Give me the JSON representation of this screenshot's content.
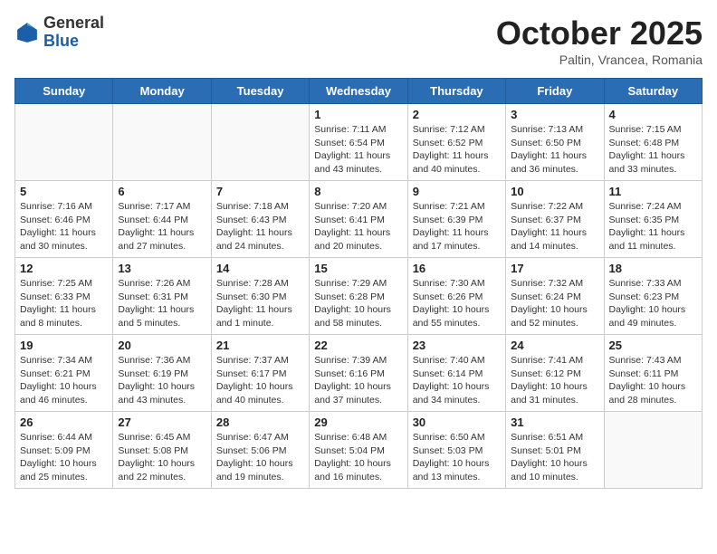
{
  "logo": {
    "general": "General",
    "blue": "Blue"
  },
  "title": "October 2025",
  "subtitle": "Paltin, Vrancea, Romania",
  "days_of_week": [
    "Sunday",
    "Monday",
    "Tuesday",
    "Wednesday",
    "Thursday",
    "Friday",
    "Saturday"
  ],
  "weeks": [
    [
      {
        "day": "",
        "info": ""
      },
      {
        "day": "",
        "info": ""
      },
      {
        "day": "",
        "info": ""
      },
      {
        "day": "1",
        "info": "Sunrise: 7:11 AM\nSunset: 6:54 PM\nDaylight: 11 hours and 43 minutes."
      },
      {
        "day": "2",
        "info": "Sunrise: 7:12 AM\nSunset: 6:52 PM\nDaylight: 11 hours and 40 minutes."
      },
      {
        "day": "3",
        "info": "Sunrise: 7:13 AM\nSunset: 6:50 PM\nDaylight: 11 hours and 36 minutes."
      },
      {
        "day": "4",
        "info": "Sunrise: 7:15 AM\nSunset: 6:48 PM\nDaylight: 11 hours and 33 minutes."
      }
    ],
    [
      {
        "day": "5",
        "info": "Sunrise: 7:16 AM\nSunset: 6:46 PM\nDaylight: 11 hours and 30 minutes."
      },
      {
        "day": "6",
        "info": "Sunrise: 7:17 AM\nSunset: 6:44 PM\nDaylight: 11 hours and 27 minutes."
      },
      {
        "day": "7",
        "info": "Sunrise: 7:18 AM\nSunset: 6:43 PM\nDaylight: 11 hours and 24 minutes."
      },
      {
        "day": "8",
        "info": "Sunrise: 7:20 AM\nSunset: 6:41 PM\nDaylight: 11 hours and 20 minutes."
      },
      {
        "day": "9",
        "info": "Sunrise: 7:21 AM\nSunset: 6:39 PM\nDaylight: 11 hours and 17 minutes."
      },
      {
        "day": "10",
        "info": "Sunrise: 7:22 AM\nSunset: 6:37 PM\nDaylight: 11 hours and 14 minutes."
      },
      {
        "day": "11",
        "info": "Sunrise: 7:24 AM\nSunset: 6:35 PM\nDaylight: 11 hours and 11 minutes."
      }
    ],
    [
      {
        "day": "12",
        "info": "Sunrise: 7:25 AM\nSunset: 6:33 PM\nDaylight: 11 hours and 8 minutes."
      },
      {
        "day": "13",
        "info": "Sunrise: 7:26 AM\nSunset: 6:31 PM\nDaylight: 11 hours and 5 minutes."
      },
      {
        "day": "14",
        "info": "Sunrise: 7:28 AM\nSunset: 6:30 PM\nDaylight: 11 hours and 1 minute."
      },
      {
        "day": "15",
        "info": "Sunrise: 7:29 AM\nSunset: 6:28 PM\nDaylight: 10 hours and 58 minutes."
      },
      {
        "day": "16",
        "info": "Sunrise: 7:30 AM\nSunset: 6:26 PM\nDaylight: 10 hours and 55 minutes."
      },
      {
        "day": "17",
        "info": "Sunrise: 7:32 AM\nSunset: 6:24 PM\nDaylight: 10 hours and 52 minutes."
      },
      {
        "day": "18",
        "info": "Sunrise: 7:33 AM\nSunset: 6:23 PM\nDaylight: 10 hours and 49 minutes."
      }
    ],
    [
      {
        "day": "19",
        "info": "Sunrise: 7:34 AM\nSunset: 6:21 PM\nDaylight: 10 hours and 46 minutes."
      },
      {
        "day": "20",
        "info": "Sunrise: 7:36 AM\nSunset: 6:19 PM\nDaylight: 10 hours and 43 minutes."
      },
      {
        "day": "21",
        "info": "Sunrise: 7:37 AM\nSunset: 6:17 PM\nDaylight: 10 hours and 40 minutes."
      },
      {
        "day": "22",
        "info": "Sunrise: 7:39 AM\nSunset: 6:16 PM\nDaylight: 10 hours and 37 minutes."
      },
      {
        "day": "23",
        "info": "Sunrise: 7:40 AM\nSunset: 6:14 PM\nDaylight: 10 hours and 34 minutes."
      },
      {
        "day": "24",
        "info": "Sunrise: 7:41 AM\nSunset: 6:12 PM\nDaylight: 10 hours and 31 minutes."
      },
      {
        "day": "25",
        "info": "Sunrise: 7:43 AM\nSunset: 6:11 PM\nDaylight: 10 hours and 28 minutes."
      }
    ],
    [
      {
        "day": "26",
        "info": "Sunrise: 6:44 AM\nSunset: 5:09 PM\nDaylight: 10 hours and 25 minutes."
      },
      {
        "day": "27",
        "info": "Sunrise: 6:45 AM\nSunset: 5:08 PM\nDaylight: 10 hours and 22 minutes."
      },
      {
        "day": "28",
        "info": "Sunrise: 6:47 AM\nSunset: 5:06 PM\nDaylight: 10 hours and 19 minutes."
      },
      {
        "day": "29",
        "info": "Sunrise: 6:48 AM\nSunset: 5:04 PM\nDaylight: 10 hours and 16 minutes."
      },
      {
        "day": "30",
        "info": "Sunrise: 6:50 AM\nSunset: 5:03 PM\nDaylight: 10 hours and 13 minutes."
      },
      {
        "day": "31",
        "info": "Sunrise: 6:51 AM\nSunset: 5:01 PM\nDaylight: 10 hours and 10 minutes."
      },
      {
        "day": "",
        "info": ""
      }
    ]
  ]
}
